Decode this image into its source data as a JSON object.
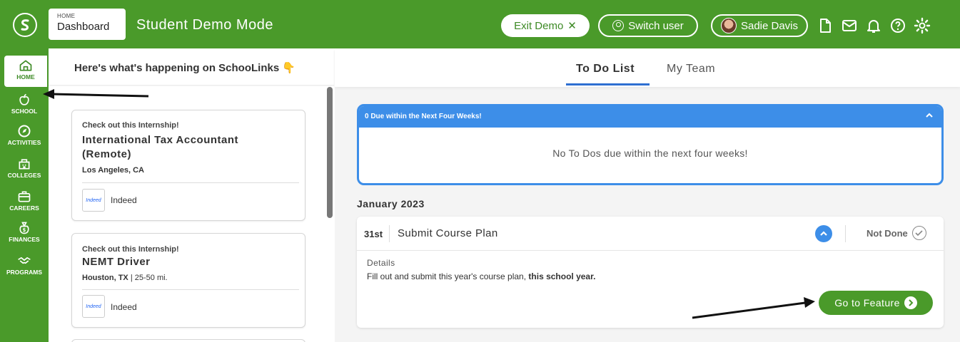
{
  "topbar": {
    "breadcrumb_small": "HOME",
    "breadcrumb_page": "Dashboard",
    "mode_title": "Student Demo Mode",
    "exit_label": "Exit Demo",
    "switch_label": "Switch user",
    "user_name": "Sadie Davis",
    "icons": [
      "document-icon",
      "mail-icon",
      "bell-icon",
      "help-icon",
      "gear-icon"
    ],
    "brand_color": "#4a9a2a"
  },
  "nav": {
    "items": [
      {
        "label": "HOME",
        "icon": "home-icon"
      },
      {
        "label": "SCHOOL",
        "icon": "apple-icon"
      },
      {
        "label": "ACTIVITIES",
        "icon": "compass-icon"
      },
      {
        "label": "COLLEGES",
        "icon": "college-icon"
      },
      {
        "label": "CAREERS",
        "icon": "briefcase-icon"
      },
      {
        "label": "FINANCES",
        "icon": "money-bag-icon"
      },
      {
        "label": "PROGRAMS",
        "icon": "handshake-icon"
      }
    ]
  },
  "feed": {
    "heading": "Here's what's happening on SchooLinks 👇",
    "cards": [
      {
        "eyebrow": "Check out this Internship!",
        "title_line1": "International Tax Accountant",
        "title_line2": "(Remote)",
        "location": "Los Angeles, CA",
        "distance": "",
        "logo_text": "Indeed",
        "source": "Indeed"
      },
      {
        "eyebrow": "Check out this Internship!",
        "title_line1": "NEMT Driver",
        "title_line2": "",
        "location": "Houston, TX",
        "distance": " | 25-50 mi.",
        "logo_text": "Indeed",
        "source": "Indeed"
      }
    ]
  },
  "main": {
    "tabs": [
      {
        "label": "To Do List",
        "active": true
      },
      {
        "label": "My Team",
        "active": false
      }
    ],
    "due_header": "0 Due within the Next Four Weeks!",
    "due_empty": "No To Dos due within the next four weeks!",
    "month": "January 2023",
    "todo": {
      "date": "31st",
      "name": "Submit Course Plan",
      "status": "Not Done",
      "details_label": "Details",
      "details_text": "Fill out and submit this year's course plan, ",
      "details_bold": "this school year.",
      "button_label": "Go to Feature"
    },
    "accent_color": "#3d8ee8"
  }
}
